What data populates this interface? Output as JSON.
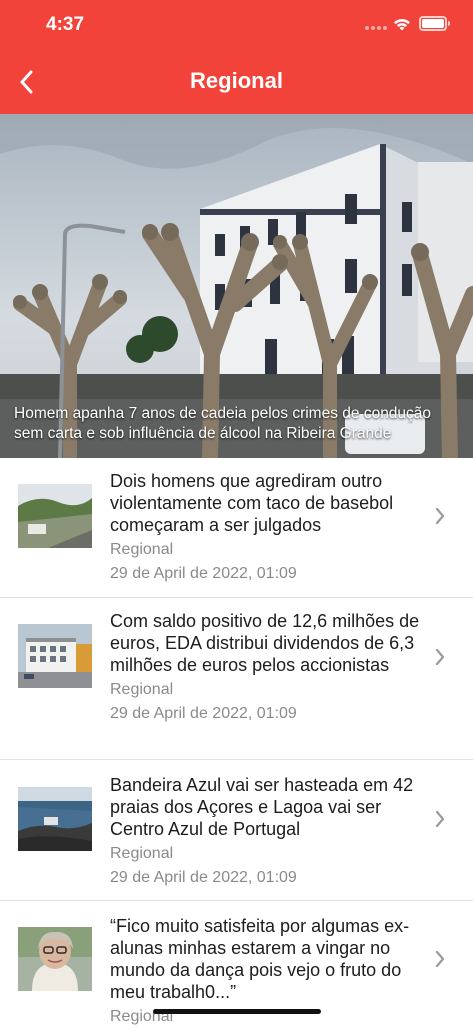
{
  "status_bar": {
    "time": "4:37"
  },
  "header": {
    "title": "Regional"
  },
  "hero": {
    "caption": "Homem apanha 7 anos de cadeia pelos crimes de condução sem carta e sob influência de álcool na Ribeira Grande"
  },
  "articles": [
    {
      "title": "Dois homens que agrediram outro violentamente com taco de basebol começaram a ser julgados",
      "category": "Regional",
      "date": "29 de April de 2022, 01:09"
    },
    {
      "title": "Com saldo positivo de 12,6 milhões de euros, EDA distribui dividendos de 6,3 milhões de euros pelos accionistas",
      "category": "Regional",
      "date": "29 de April de 2022, 01:09"
    },
    {
      "title": "Bandeira Azul vai ser hasteada em 42 praias dos Açores e Lagoa vai ser Centro Azul de Portugal",
      "category": "Regional",
      "date": "29 de April de 2022, 01:09"
    },
    {
      "title": "“Fico muito satisfeita por algumas ex-alunas  minhas estarem a vingar no mundo da dança  pois vejo o fruto do meu trabalh0...”",
      "category": "Regional",
      "date": ""
    }
  ],
  "colors": {
    "header": "#f2433a",
    "text": "#1d1d1d",
    "meta": "#8a8a8a"
  },
  "icons": [
    "back-chevron-icon",
    "wifi-icon",
    "battery-icon",
    "chevron-right-icon"
  ]
}
